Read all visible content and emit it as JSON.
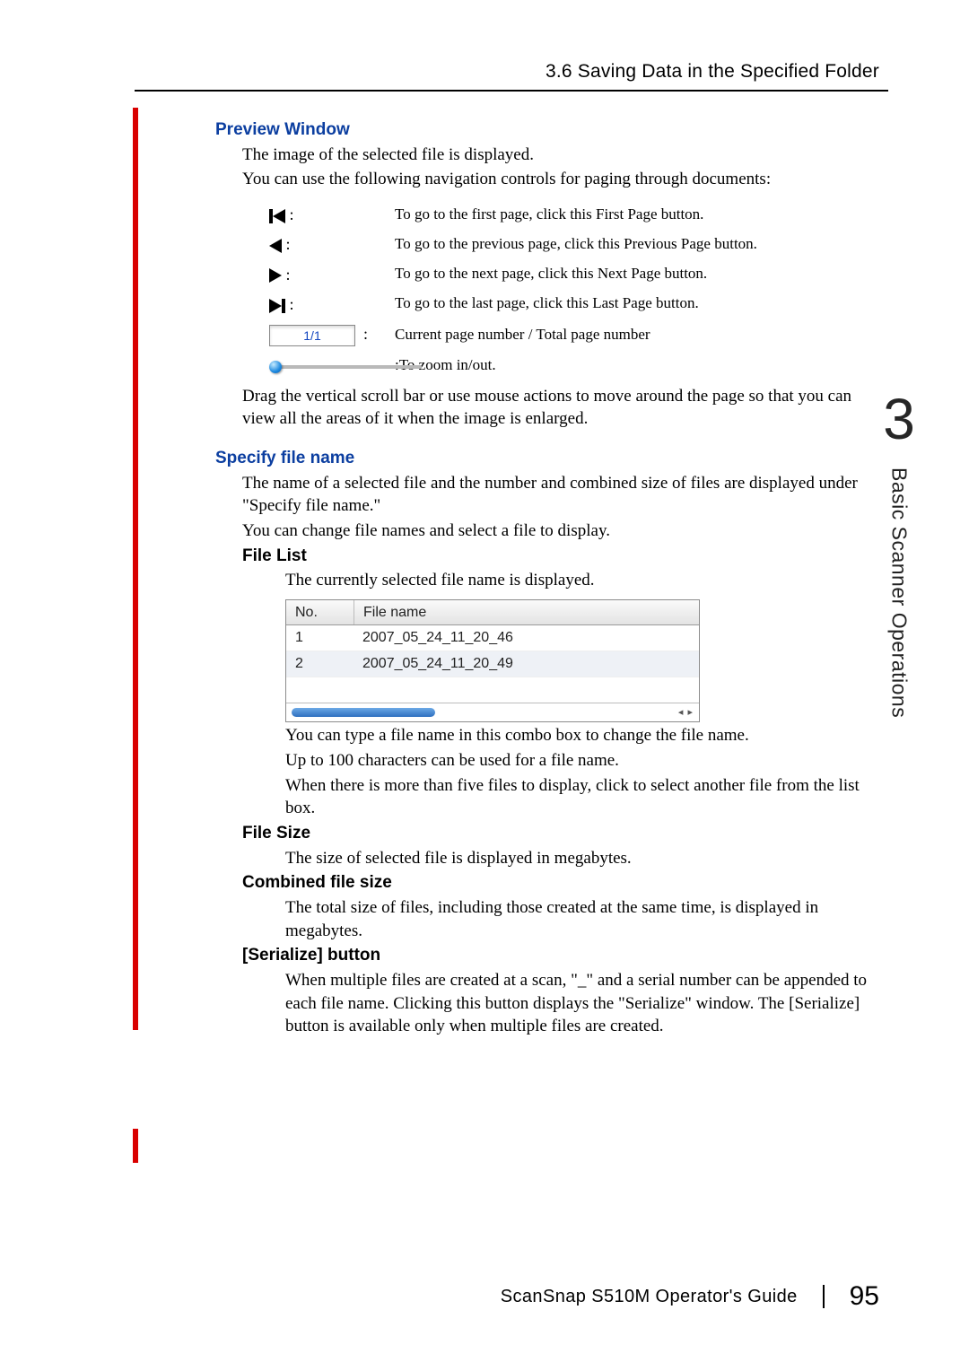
{
  "header": {
    "title": "3.6 Saving Data in the Specified Folder"
  },
  "sidebar": {
    "chapter": "3",
    "section": "Basic Scanner Operations"
  },
  "preview": {
    "heading": "Preview Window",
    "intro1": "The image of the selected file is displayed.",
    "intro2": "You can use the following navigation controls for paging through documents:",
    "nav": {
      "first": "To go to the first page, click this First Page button.",
      "prev": "To go to the previous page, click this Previous Page button.",
      "next": "To go to the next page, click this Next Page button.",
      "last": "To go to the last page, click this Last Page button.",
      "counter_value": "1/1",
      "counter_desc": "Current page number / Total page number",
      "zoom_desc": ":To zoom in/out."
    },
    "after": "Drag the vertical scroll bar or use mouse actions to move around the page so that you can view all the areas of it when the image is enlarged."
  },
  "specify": {
    "heading": "Specify file name",
    "p1": "The name of a selected file and the number and combined size of files are displayed under \"Specify file name.\"",
    "p2": "You can change file names and select a file to display."
  },
  "filelist": {
    "heading": "File List",
    "intro": "The currently selected file name is displayed.",
    "cols": {
      "no": "No.",
      "file": "File name"
    },
    "rows": [
      {
        "no": "1",
        "name": "2007_05_24_11_20_46"
      },
      {
        "no": "2",
        "name": "2007_05_24_11_20_49"
      }
    ],
    "after1": "You can type a file name in this combo box to change the file name.",
    "after2": "Up to 100 characters can be used for a file name.",
    "after3": "When there is more than five files to display, click to select another file from the list box."
  },
  "filesize": {
    "heading": "File Size",
    "body": "The size of selected file is displayed in megabytes."
  },
  "combined": {
    "heading": "Combined file size",
    "body": "The total size of files, including those created at the same time, is displayed in megabytes."
  },
  "serialize": {
    "heading": "[Serialize] button",
    "body": "When multiple files are created at a scan, \"_\" and a serial number can be appended to each file name. Clicking this button displays the \"Serialize\" window. The [Serialize] button is available only when multiple files are created."
  },
  "footer": {
    "title": "ScanSnap S510M Operator's Guide",
    "page": "95"
  }
}
